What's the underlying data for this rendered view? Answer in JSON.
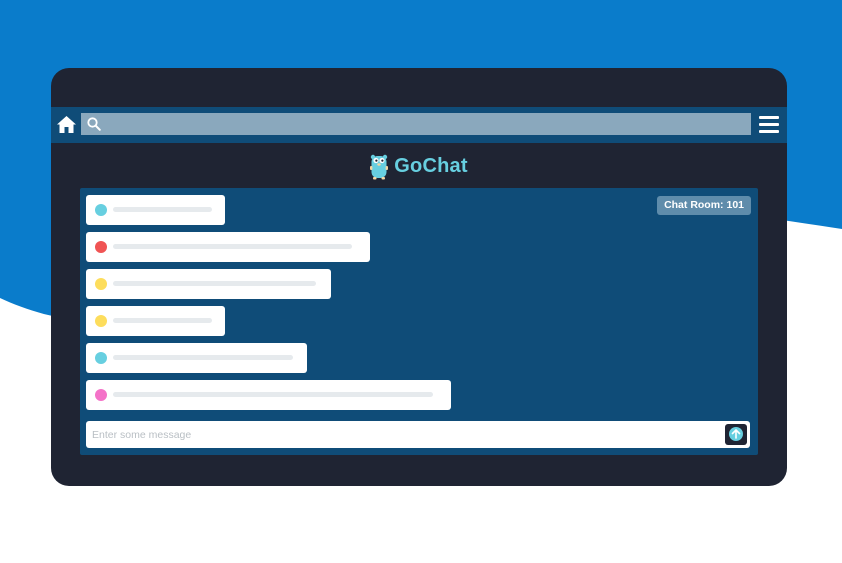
{
  "app": {
    "name": "GoChat"
  },
  "search": {
    "placeholder": ""
  },
  "chat": {
    "room_label": "Chat Room: 101",
    "messages": [
      {
        "color": "#67cfe0"
      },
      {
        "color": "#f05454"
      },
      {
        "color": "#fddd5c"
      },
      {
        "color": "#fddd5c"
      },
      {
        "color": "#67cfe0"
      },
      {
        "color": "#f472c8"
      }
    ]
  },
  "composer": {
    "placeholder": "Enter some message"
  },
  "icons": {
    "home": "home-icon",
    "search": "search-icon",
    "menu": "hamburger-menu-icon",
    "send": "arrow-up-icon",
    "logo": "gopher-logo-icon"
  },
  "colors": {
    "background_blue": "#0a7ccb",
    "device": "#1f2433",
    "panel": "#0f4c78",
    "accent": "#67cfe0"
  }
}
